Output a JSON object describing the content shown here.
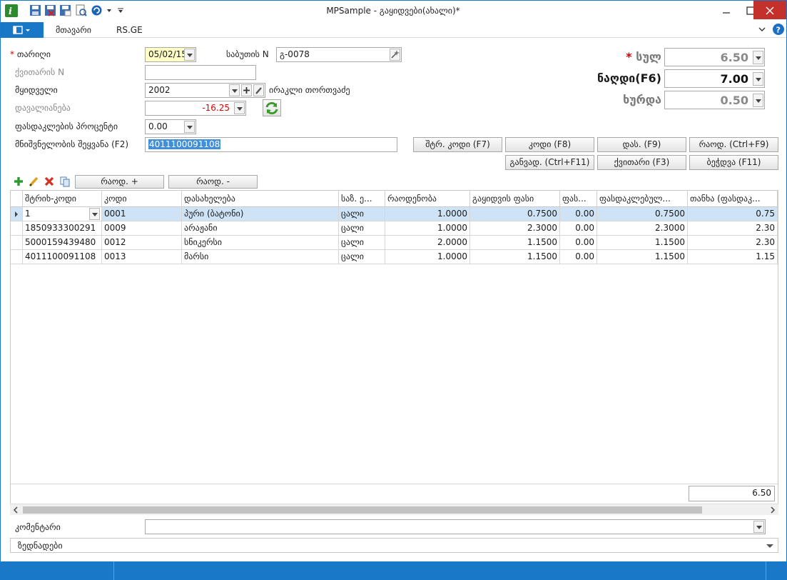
{
  "window": {
    "title": "MPSample - გაყიდვები(ახალი)*"
  },
  "ribbon": {
    "tabs": [
      "მთავარი",
      "RS.GE"
    ]
  },
  "form": {
    "date": {
      "label": "თარიღი",
      "value": "05/02/15"
    },
    "doc_no": {
      "label": "საბუთის N",
      "value": "გ-0078"
    },
    "invoice_no": {
      "label": "ქვითარის N",
      "value": ""
    },
    "buyer": {
      "label": "მყიდველი",
      "value": "2002",
      "name": "ირაკლი თორთვაძე"
    },
    "debt": {
      "label": "დავალიანება",
      "value": "-16.25"
    },
    "discount_pct": {
      "label": "ფასდაკლების პროცენტი",
      "value": "0.00"
    },
    "value_entry": {
      "label": "მნიშვნელობის შეყვანა (F2)",
      "value": "4011100091108"
    }
  },
  "totals": {
    "sum": {
      "label": "სულ",
      "value": "6.50"
    },
    "cash": {
      "label": "ნაღდი(F6)",
      "value": "7.00"
    },
    "change": {
      "label": "ხურდა",
      "value": "0.50"
    }
  },
  "buttons": {
    "barcode": "შტრ. კოდი (F7)",
    "code": "კოდი (F8)",
    "name": "დას. (F9)",
    "qty": "რაოდ. (Ctrl+F9)",
    "installment": "განვად. (Ctrl+F11)",
    "receipt": "ქვითარი (F3)",
    "print": "ბეჭდვა (F11)",
    "qty_plus": "რაოდ. +",
    "qty_minus": "რაოდ. -"
  },
  "grid": {
    "columns": [
      "შტრიხ-კოდი",
      "კოდი",
      "დასახელება",
      "საზ. ე...",
      "რაოდენობა",
      "გაყიდვის ფასი",
      "ფას...",
      "ფასდაკლებულ...",
      "თანხა (ფასდაკ..."
    ],
    "rows": [
      [
        "1",
        "0001",
        "პური (ბატონი)",
        "ცალი",
        "1.0000",
        "0.7500",
        "0.00",
        "0.7500",
        "0.75"
      ],
      [
        "1850933300291",
        "0009",
        "არაჟანი",
        "ცალი",
        "1.0000",
        "2.3000",
        "0.00",
        "2.3000",
        "2.30"
      ],
      [
        "5000159439480",
        "0012",
        "სნიკერსი",
        "ცალი",
        "2.0000",
        "1.1500",
        "0.00",
        "1.1500",
        "2.30"
      ],
      [
        "4011100091108",
        "0013",
        "მარსი",
        "ცალი",
        "1.0000",
        "1.1500",
        "0.00",
        "1.1500",
        "1.15"
      ]
    ],
    "footer_total": "6.50"
  },
  "bottom": {
    "comment_label": "კომენტარი",
    "comment_value": "",
    "additional": "ზედნადები"
  }
}
